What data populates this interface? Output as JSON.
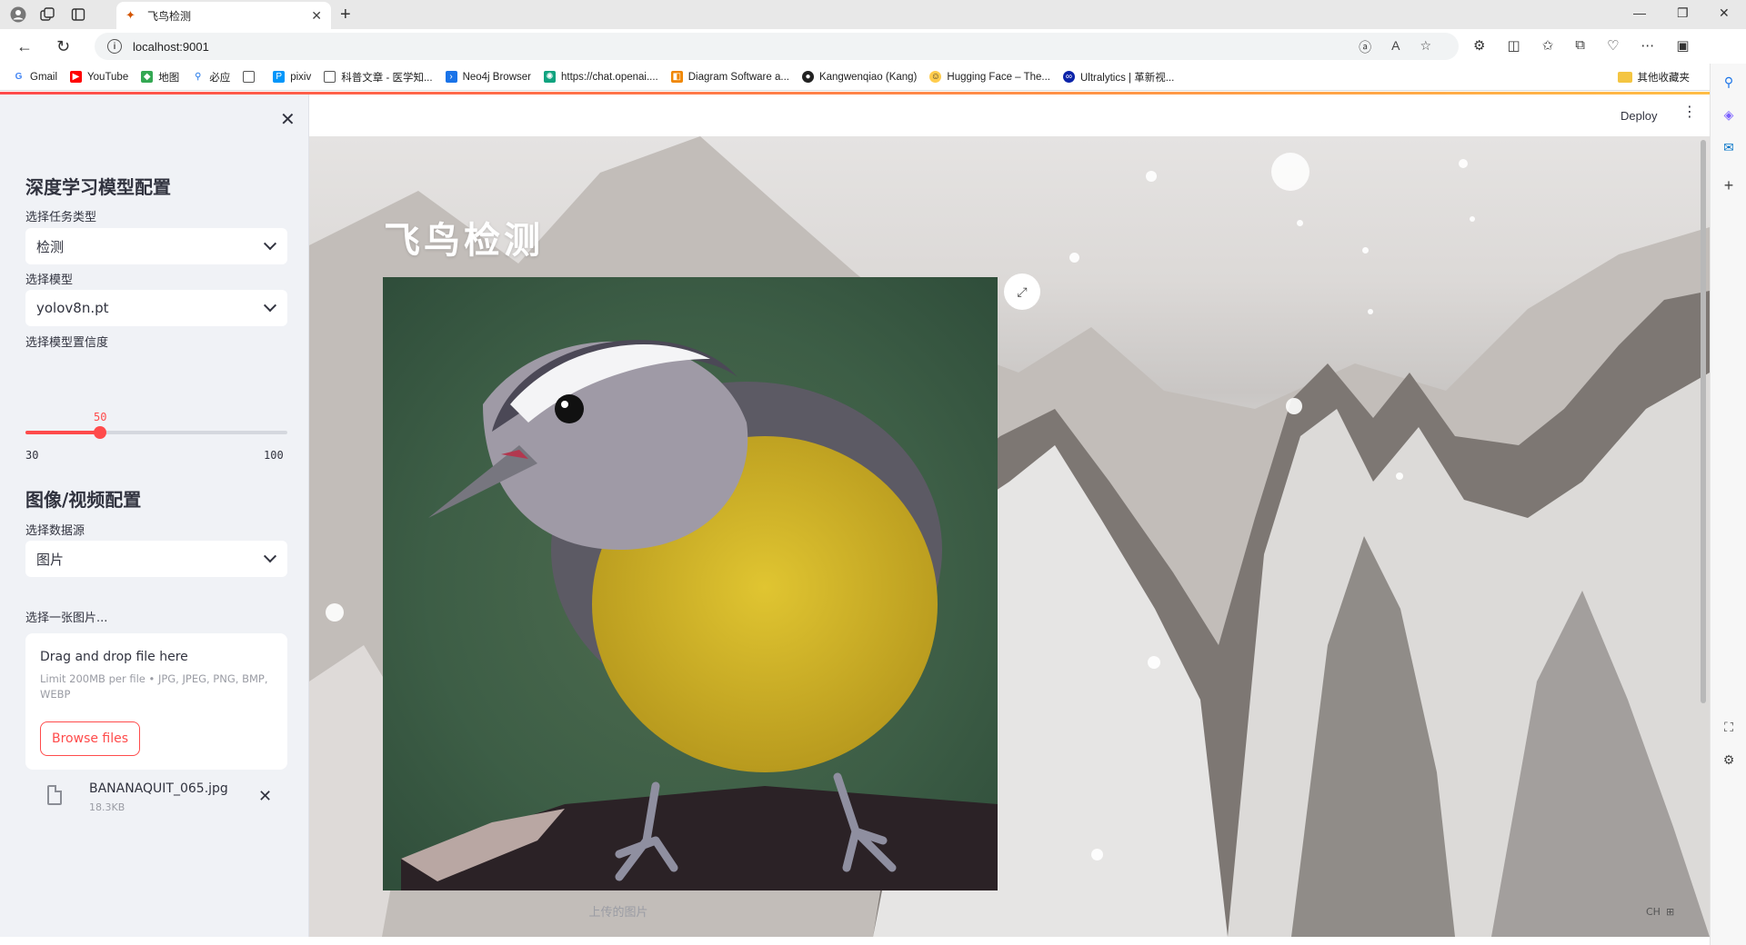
{
  "browser": {
    "tab_title": "飞鸟检测",
    "url": "localhost:9001",
    "new_tab_glyph": "+",
    "bookmarks": [
      {
        "label": "Gmail",
        "icon": "google-icon",
        "color": "#4285f4"
      },
      {
        "label": "YouTube",
        "icon": "youtube-icon",
        "color": "#ff0000"
      },
      {
        "label": "地图",
        "icon": "maps-icon",
        "color": "#34a853"
      },
      {
        "label": "必应",
        "icon": "bing-search-icon",
        "color": "#1a73e8"
      },
      {
        "label": "",
        "icon": "document-icon",
        "color": "#555555"
      },
      {
        "label": "pixiv",
        "icon": "pixiv-icon",
        "color": "#0096fa"
      },
      {
        "label": "科普文章 - 医学知...",
        "icon": "document-icon",
        "color": "#555555"
      },
      {
        "label": "Neo4j Browser",
        "icon": "neo4j-icon",
        "color": "#1a73e8"
      },
      {
        "label": "https://chat.openai....",
        "icon": "openai-icon",
        "color": "#10a37f"
      },
      {
        "label": "Diagram Software a...",
        "icon": "drawio-icon",
        "color": "#f08705"
      },
      {
        "label": "Kangwenqiao (Kang)",
        "icon": "github-icon",
        "color": "#222222"
      },
      {
        "label": "Hugging Face – The...",
        "icon": "huggingface-icon",
        "color": "#ffcc4d"
      },
      {
        "label": "Ultralytics | 革新视...",
        "icon": "ultralytics-icon",
        "color": "#0b23a9"
      }
    ],
    "bookmarks_folder": "其他收藏夹"
  },
  "sidebar": {
    "model_section_title": "深度学习模型配置",
    "task_label": "选择任务类型",
    "task_value": "检测",
    "model_label": "选择模型",
    "model_value": "yolov8n.pt",
    "confidence_label": "选择模型置信度",
    "confidence_value": "50",
    "confidence_min": "30",
    "confidence_max": "100",
    "media_section_title": "图像/视频配置",
    "source_label": "选择数据源",
    "source_value": "图片",
    "upload_label": "选择一张图片...",
    "dropzone_title": "Drag and drop file here",
    "dropzone_limits": "Limit 200MB per file • JPG, JPEG, PNG, BMP, WEBP",
    "browse_label": "Browse files",
    "file_name": "BANANAQUIT_065.jpg",
    "file_size": "18.3KB"
  },
  "main": {
    "deploy_label": "Deploy",
    "page_title": "飞鸟检测",
    "image_caption": "上传的图片",
    "ime_text": "CH"
  },
  "colors": {
    "accent": "#ff4b4b",
    "sidebar_bg": "#f0f2f6",
    "text": "#31333f"
  }
}
